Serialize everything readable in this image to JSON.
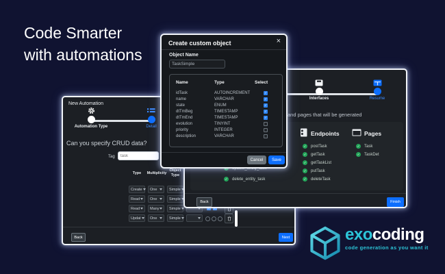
{
  "headline": {
    "line1": "Code Smarter",
    "line2": "with automations"
  },
  "automation_window": {
    "title": "New Automation",
    "steps": [
      {
        "label": "Automation Type",
        "active": false
      },
      {
        "label": "Detail",
        "active": true
      }
    ],
    "question": "Can you specify CRUD data?",
    "tag_label": "Tag",
    "tag_placeholder": "task",
    "table_headers": [
      "Type",
      "Multiplicity",
      "Object Type"
    ],
    "rows": [
      {
        "type": "Create",
        "multiplicity": "One",
        "object_type": "Simple"
      },
      {
        "type": "Read",
        "multiplicity": "One",
        "object_type": "Simple"
      },
      {
        "type": "Read",
        "multiplicity": "Many",
        "object_type": "Simple"
      },
      {
        "type": "Updat",
        "multiplicity": "One",
        "object_type": "Simple"
      }
    ],
    "back_label": "Back",
    "next_label": "Next"
  },
  "modal": {
    "title": "Create custom object",
    "close_icon": "×",
    "object_name_label": "Object Name",
    "object_name_value": "TaskSimple",
    "table": {
      "headers": [
        "Name",
        "Type",
        "Select"
      ],
      "rows": [
        {
          "name": "idTask",
          "type": "AUTOINCREMENT",
          "checked": true
        },
        {
          "name": "name",
          "type": "VARCHAR",
          "checked": true
        },
        {
          "name": "state",
          "type": "ENUM",
          "checked": true
        },
        {
          "name": "dtTmBeg",
          "type": "TIMESTAMP",
          "checked": true
        },
        {
          "name": "dtTmEnd",
          "type": "TIMESTAMP",
          "checked": true
        },
        {
          "name": "evolution",
          "type": "TINYINT",
          "checked": false
        },
        {
          "name": "priority",
          "type": "INTEGER",
          "checked": false
        },
        {
          "name": "description",
          "type": "VARCHAR",
          "checked": false
        }
      ]
    },
    "cancel_label": "Cancel",
    "save_label": "Save"
  },
  "generation_window": {
    "steps": [
      {
        "label": "Interfaces",
        "active": false
      },
      {
        "label": "Resume",
        "active": true
      }
    ],
    "description": "and pages that will be generated",
    "partial_endpoint_items": [
      "update_entity_task",
      "delete_entity_task"
    ],
    "endpoints": {
      "title": "Endpoints",
      "items": [
        "postTask",
        "getTask",
        "getTaskList",
        "putTask",
        "deleteTask"
      ]
    },
    "pages": {
      "title": "Pages",
      "items": [
        "Task",
        "TaskDet"
      ]
    },
    "back_label": "Back",
    "finish_label": "Finish"
  },
  "logo": {
    "brand_primary": "exo",
    "brand_secondary": "coding",
    "tagline": "code generation as you want it"
  },
  "colors": {
    "accent_blue": "#0d6efd",
    "success_green": "#23a559",
    "brand_teal": "#2cc5d8",
    "background_navy": "#101331"
  }
}
